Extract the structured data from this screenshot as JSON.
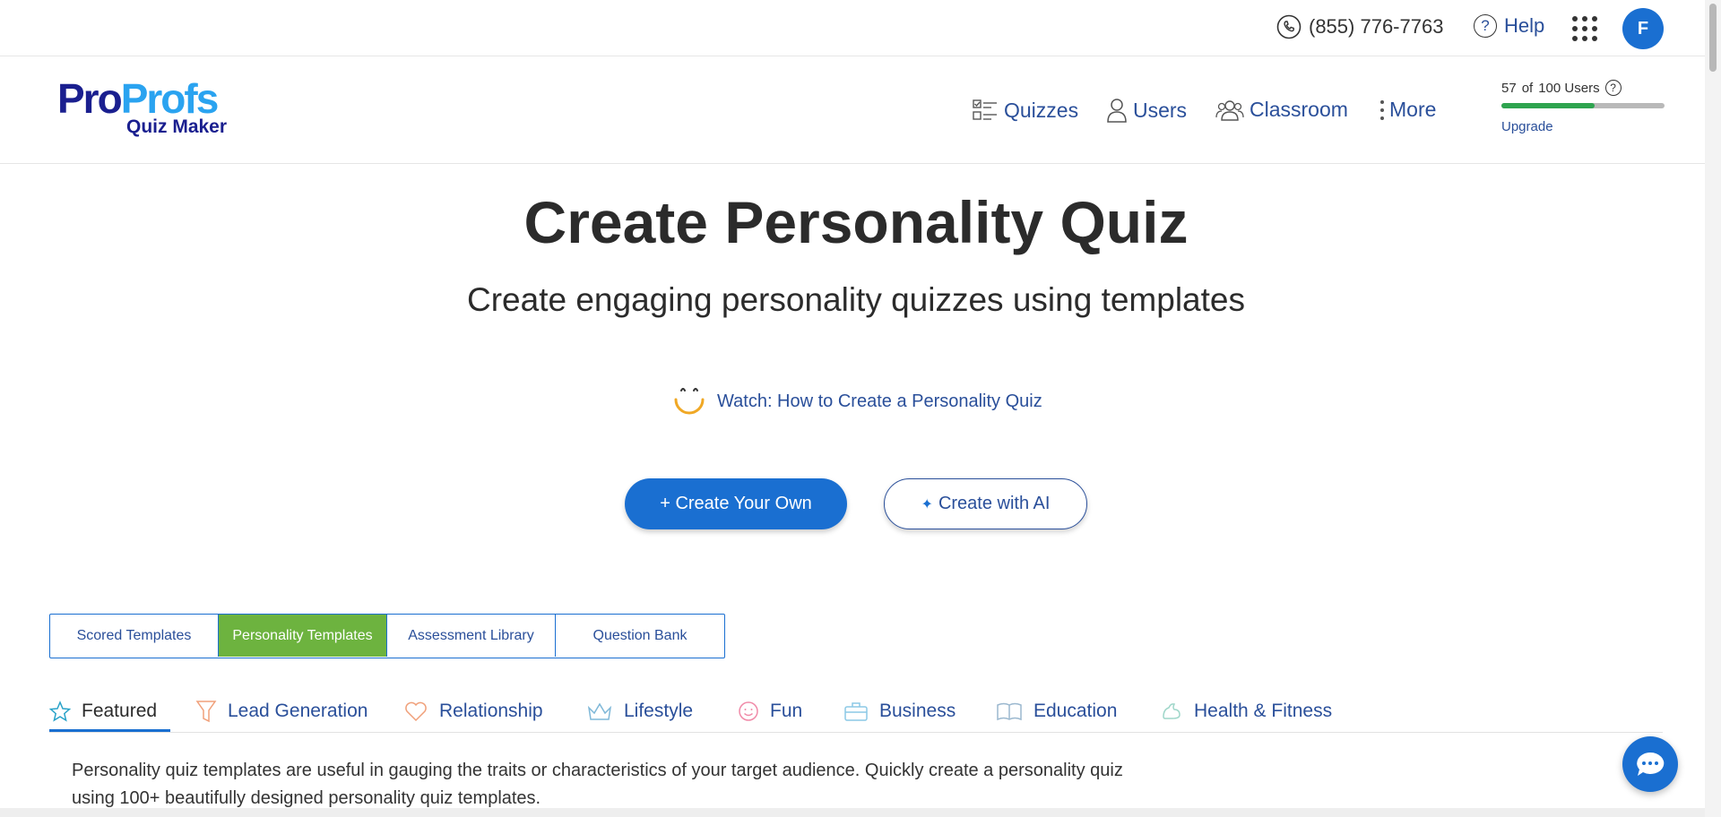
{
  "topbar": {
    "phone": "(855) 776-7763",
    "help": "Help",
    "avatar_initial": "F"
  },
  "brand": {
    "logo_part1": "Pro",
    "logo_part2": "Profs",
    "logo_sub": "Quiz Maker",
    "color_dark": "#1a1f8f",
    "color_light": "#2aa3f0"
  },
  "nav": {
    "items": [
      {
        "label": "Quizzes",
        "icon": "checklist-icon"
      },
      {
        "label": "Users",
        "icon": "user-icon"
      },
      {
        "label": "Classroom",
        "icon": "group-icon"
      },
      {
        "label": "More",
        "icon": "kebab-icon"
      }
    ]
  },
  "users_meter": {
    "used": "57",
    "of": "of",
    "total": "100 Users",
    "fraction": 0.57,
    "upgrade": "Upgrade"
  },
  "hero": {
    "title": "Create Personality Quiz",
    "subtitle": "Create engaging personality quizzes using templates",
    "watch_link": "Watch: How to Create a Personality Quiz"
  },
  "actions": {
    "create_own": "+ Create Your Own",
    "create_ai": "Create with AI"
  },
  "template_tabs": [
    {
      "label": "Scored Templates",
      "active": false
    },
    {
      "label": "Personality Templates",
      "active": true
    },
    {
      "label": "Assessment Library",
      "active": false
    },
    {
      "label": "Question Bank",
      "active": false
    }
  ],
  "categories": [
    {
      "label": "Featured",
      "icon": "star-icon",
      "active": true
    },
    {
      "label": "Lead Generation",
      "icon": "funnel-icon"
    },
    {
      "label": "Relationship",
      "icon": "heart-icon"
    },
    {
      "label": "Lifestyle",
      "icon": "crown-icon"
    },
    {
      "label": "Fun",
      "icon": "smiley-icon"
    },
    {
      "label": "Business",
      "icon": "briefcase-icon"
    },
    {
      "label": "Education",
      "icon": "book-icon"
    },
    {
      "label": "Health & Fitness",
      "icon": "fitness-icon"
    }
  ],
  "description": "Personality quiz templates are useful in gauging the traits or characteristics of your target audience. Quickly create a personality quiz using 100+ beautifully designed personality quiz templates.",
  "colors": {
    "primary": "#1a6fd1",
    "active_tab": "#6db33f",
    "link": "#2a4f9a"
  }
}
